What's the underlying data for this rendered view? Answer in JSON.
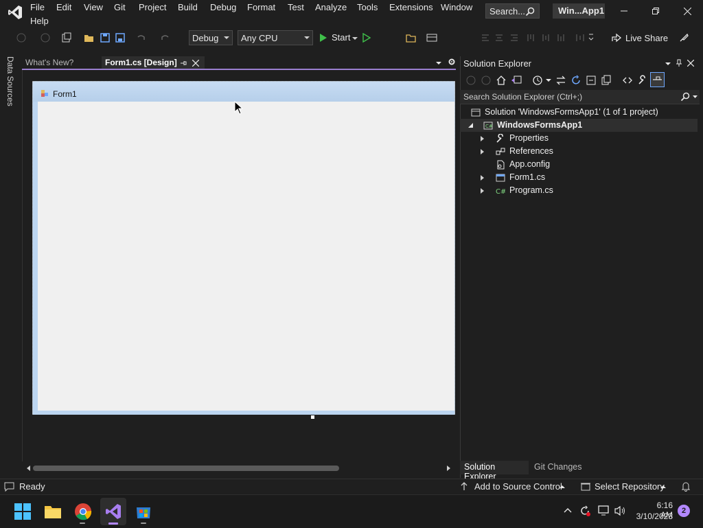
{
  "menu": {
    "items": [
      "File",
      "Edit",
      "View",
      "Git",
      "Project",
      "Build",
      "Debug",
      "Format",
      "Test",
      "Analyze",
      "Tools",
      "Extensions",
      "Window",
      "Help"
    ]
  },
  "search": {
    "label": "Search..."
  },
  "window": {
    "title": "Win...App1"
  },
  "toolbar": {
    "config": "Debug",
    "platform": "Any CPU",
    "start_label": "Start",
    "live_share": "Live Share"
  },
  "left_rail": {
    "data_sources": "Data Sources"
  },
  "doc_tabs": {
    "whats_new": "What's New?",
    "form1_design": "Form1.cs [Design]"
  },
  "designer": {
    "form_title": "Form1"
  },
  "solution_explorer": {
    "title": "Solution Explorer",
    "search_placeholder": "Search Solution Explorer (Ctrl+;)",
    "solution": "Solution 'WindowsFormsApp1' (1 of 1 project)",
    "project": "WindowsFormsApp1",
    "items": [
      "Properties",
      "References",
      "App.config",
      "Form1.cs",
      "Program.cs"
    ],
    "bottom_tabs": [
      "Solution Explorer",
      "Git Changes"
    ]
  },
  "status": {
    "ready": "Ready",
    "add_source": "Add to Source Control",
    "select_repo": "Select Repository"
  },
  "taskbar": {
    "time": "6:16 AM",
    "date": "3/10/2023",
    "notifications": "2"
  },
  "colors": {
    "accent": "#9a7fd0",
    "vs_purple": "#b388ff",
    "form_title_bg": "#bcd5f0"
  }
}
